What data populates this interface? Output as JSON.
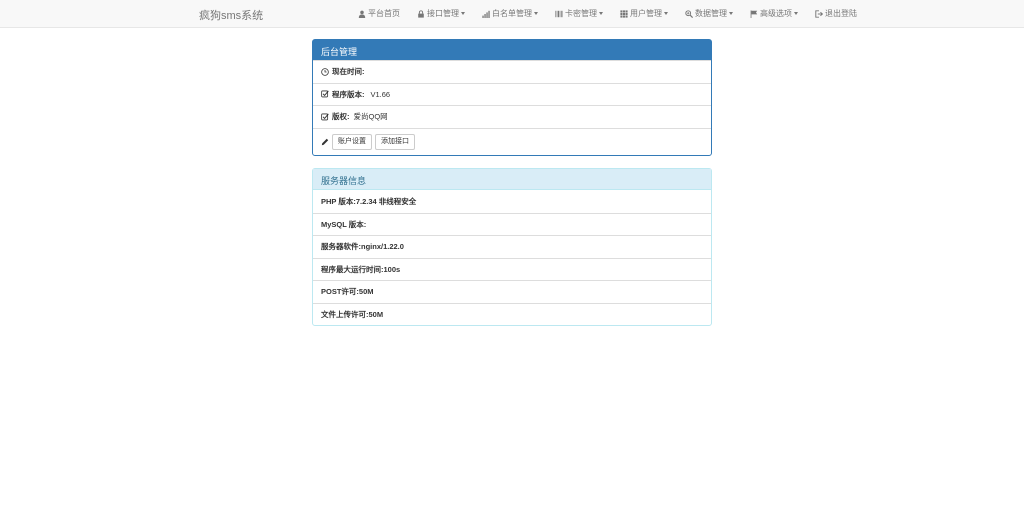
{
  "brand": "疯狗sms系统",
  "nav": [
    {
      "label": "平台首页",
      "icon": "user-icon",
      "dropdown": false
    },
    {
      "label": "接口管理",
      "icon": "lock-icon",
      "dropdown": true
    },
    {
      "label": "白名单管理",
      "icon": "signal-icon",
      "dropdown": true
    },
    {
      "label": "卡密管理",
      "icon": "barcode-icon",
      "dropdown": true
    },
    {
      "label": "用户管理",
      "icon": "grid-icon",
      "dropdown": true
    },
    {
      "label": "数据管理",
      "icon": "zoom-in-icon",
      "dropdown": true
    },
    {
      "label": "高级选项",
      "icon": "flag-icon",
      "dropdown": true
    },
    {
      "label": "退出登陆",
      "icon": "log-out-icon",
      "dropdown": false
    }
  ],
  "admin_panel": {
    "title": "后台管理",
    "time_label": "现在时间:",
    "version_label": "程序版本:",
    "version_value": "V1.66",
    "copyright_label": "版权:",
    "copyright_value": "爱尚QQ网",
    "btn_account": "账户设置",
    "btn_add_api": "添加接口"
  },
  "server_panel": {
    "title": "服务器信息",
    "rows": [
      "PHP 版本:7.2.34 非线程安全",
      "MySQL 版本:",
      "服务器软件:nginx/1.22.0",
      "程序最大运行时间:100s",
      "POST许可:50M",
      "文件上传许可:50M"
    ]
  },
  "colors": {
    "primary": "#337ab7",
    "info_bg": "#d9edf7",
    "info_text": "#31708f"
  }
}
